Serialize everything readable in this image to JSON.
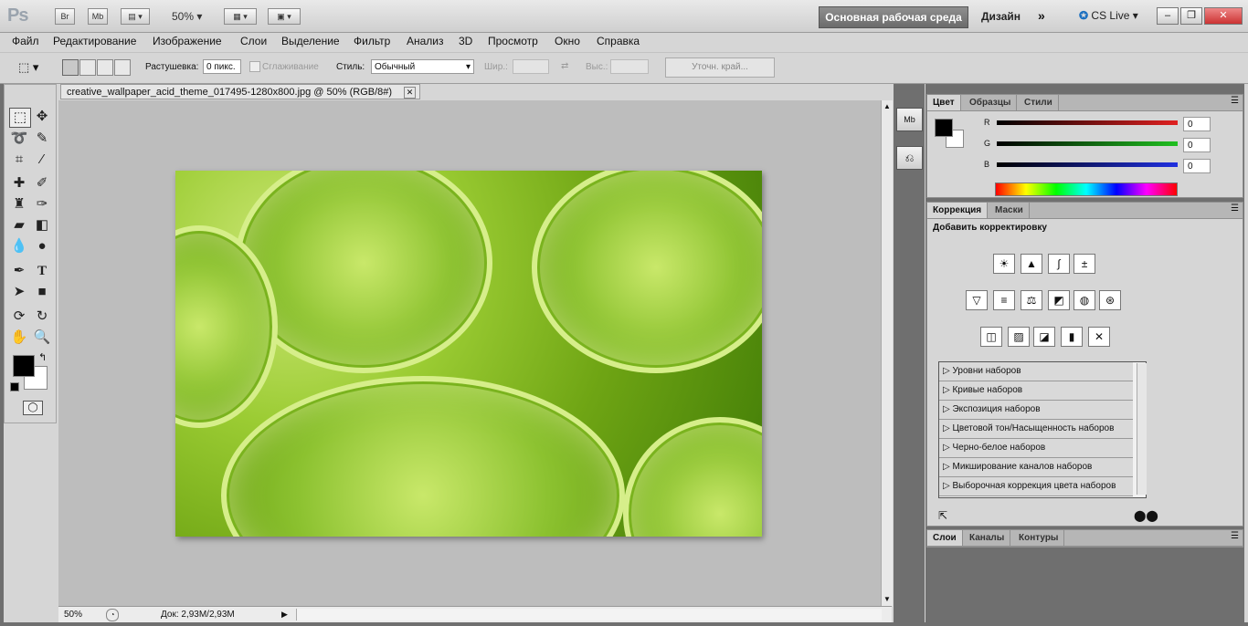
{
  "app": {
    "logo": "Ps",
    "bridge": "Br",
    "mini_bridge": "Mb",
    "zoom": "50%",
    "workspace": "Основная рабочая среда",
    "design": "Дизайн",
    "more": "»",
    "cs_live": "CS Live"
  },
  "menu": [
    "Файл",
    "Редактирование",
    "Изображение",
    "Слои",
    "Выделение",
    "Фильтр",
    "Анализ",
    "3D",
    "Просмотр",
    "Окно",
    "Справка"
  ],
  "options": {
    "feather_label": "Растушевка:",
    "feather_value": "0 пикс.",
    "antialias_label": "Сглаживание",
    "style_label": "Стиль:",
    "style_value": "Обычный",
    "width_label": "Шир.:",
    "height_label": "Выс.:",
    "refine_edge": "Уточн. край..."
  },
  "document": {
    "tab_title": "creative_wallpaper_acid_theme_017495-1280x800.jpg @ 50% (RGB/8#)",
    "zoom": "50%",
    "doc_info": "Док: 2,93M/2,93M"
  },
  "color_panel": {
    "tabs": [
      "Цвет",
      "Образцы",
      "Стили"
    ],
    "r_label": "R",
    "r_value": "0",
    "g_label": "G",
    "g_value": "0",
    "b_label": "B",
    "b_value": "0",
    "colors": {
      "r": "#e02020",
      "g": "#20c020",
      "b": "#2030e0",
      "fg": "#000000",
      "bg": "#ffffff"
    }
  },
  "adjust_panel": {
    "tabs": [
      "Коррекция",
      "Маски"
    ],
    "header": "Добавить корректировку",
    "presets": [
      "Уровни наборов",
      "Кривые наборов",
      "Экспозиция наборов",
      "Цветовой тон/Насыщенность наборов",
      "Черно-белое наборов",
      "Микширование каналов наборов",
      "Выборочная коррекция цвета наборов"
    ]
  },
  "layers_panel": {
    "tabs": [
      "Слои",
      "Каналы",
      "Контуры"
    ]
  }
}
